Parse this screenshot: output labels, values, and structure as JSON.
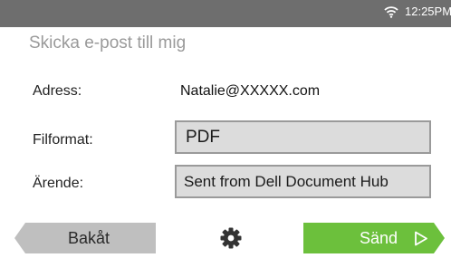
{
  "status_bar": {
    "wifi_icon": "wifi-icon",
    "time": "12:25PM"
  },
  "title": "Skicka e-post till mig",
  "form": {
    "address_label": "Adress:",
    "address_value": "Natalie@XXXXX.com",
    "format_label": "Filformat:",
    "format_value": "PDF",
    "subject_label": "Ärende:",
    "subject_value": "Sent from Dell Document Hub"
  },
  "footer": {
    "back_label": "Bakåt",
    "settings_icon": "gear-icon",
    "send_label": "Sänd",
    "send_icon": "play-arrow-icon"
  },
  "colors": {
    "status_bar": "#6e6e6e",
    "title": "#9a9a9a",
    "field_bg": "#dcdcdc",
    "back_button": "#bfbfbf",
    "send_button": "#6cc03c"
  }
}
